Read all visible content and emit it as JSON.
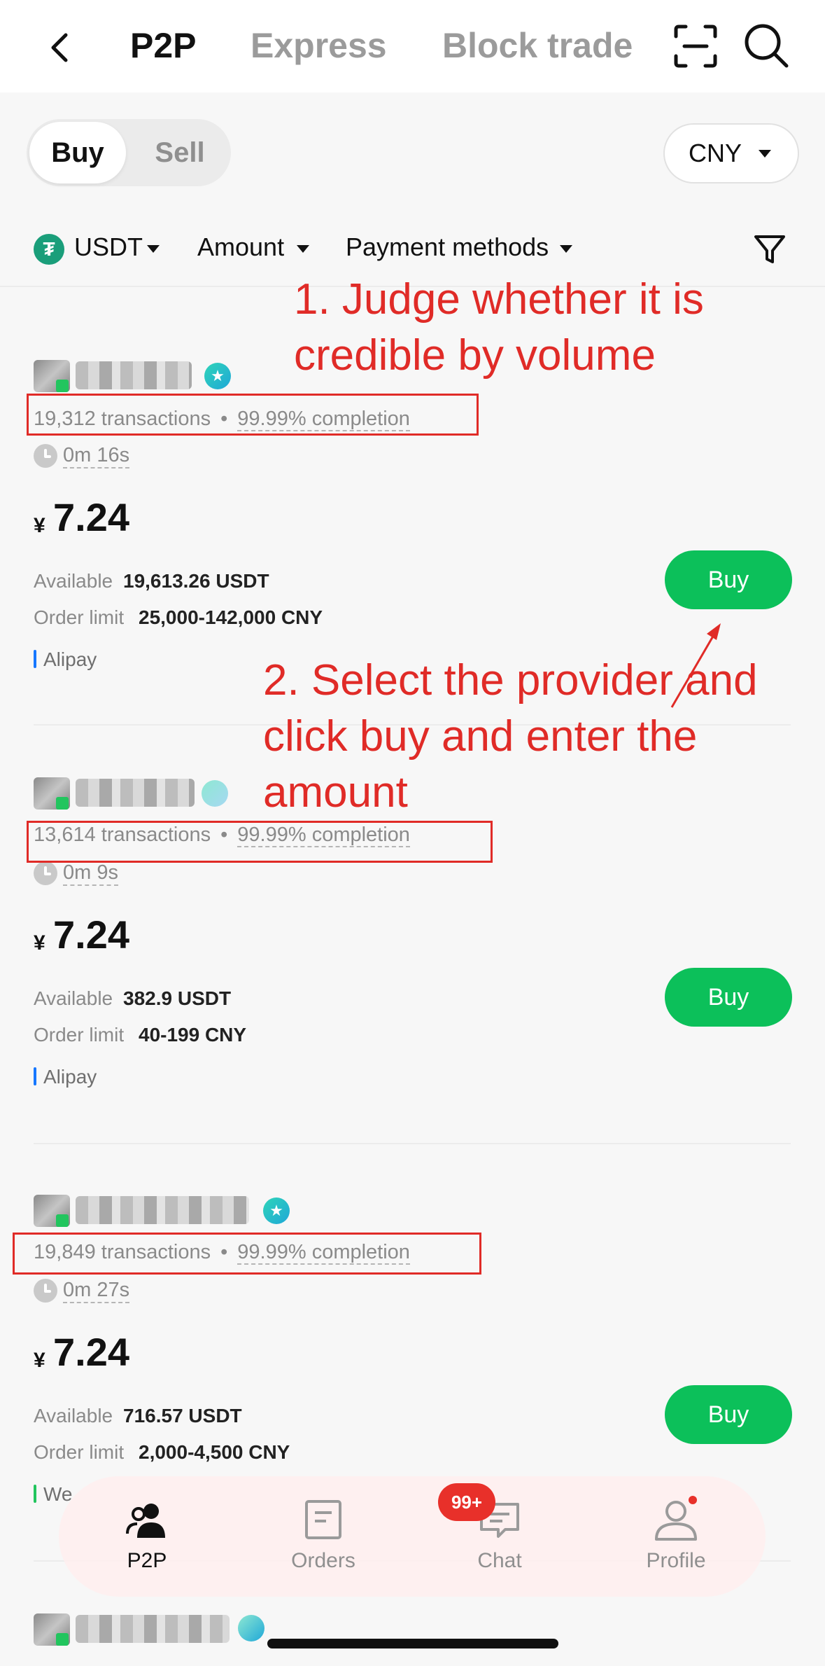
{
  "header": {
    "tabs": [
      {
        "label": "P2P",
        "active": true
      },
      {
        "label": "Express",
        "active": false
      },
      {
        "label": "Block trade",
        "active": false
      }
    ],
    "icons": [
      "back-icon",
      "scan-icon",
      "search-icon"
    ]
  },
  "trade_toggle": {
    "buy": "Buy",
    "sell": "Sell",
    "selected": "Buy"
  },
  "fiat": {
    "label": "CNY"
  },
  "filters": {
    "asset_icon_glyph": "₮",
    "asset": "USDT",
    "amount": "Amount",
    "payment": "Payment methods"
  },
  "listings": [
    {
      "transactions": "19,312 transactions",
      "completion": "99.99% completion",
      "pay_time": "0m 16s",
      "currency_symbol": "¥",
      "price": "7.24",
      "available_label": "Available",
      "available": "19,613.26 USDT",
      "limit_label": "Order limit",
      "limit": "25,000-142,000 CNY",
      "payment": "Alipay",
      "buy_label": "Buy"
    },
    {
      "transactions": "13,614 transactions",
      "completion": "99.99% completion",
      "pay_time": "0m 9s",
      "currency_symbol": "¥",
      "price": "7.24",
      "available_label": "Available",
      "available": "382.9 USDT",
      "limit_label": "Order limit",
      "limit": "40-199 CNY",
      "payment": "Alipay",
      "buy_label": "Buy"
    },
    {
      "transactions": "19,849 transactions",
      "completion": "99.99% completion",
      "pay_time": "0m 27s",
      "currency_symbol": "¥",
      "price": "7.24",
      "available_label": "Available",
      "available": "716.57 USDT",
      "limit_label": "Order limit",
      "limit": "2,000-4,500 CNY",
      "payment": "We",
      "buy_label": "Buy"
    }
  ],
  "annotations": {
    "note1_line1": "1. Judge whether it is",
    "note1_line2": "credible by volume",
    "note2_line1": "2. Select the provider and",
    "note2_line2": "click buy and enter the",
    "note2_line3": "amount"
  },
  "bottom_nav": [
    {
      "label": "P2P",
      "active": true
    },
    {
      "label": "Orders",
      "active": false
    },
    {
      "label": "Chat",
      "active": false
    },
    {
      "label": "Profile",
      "active": false
    }
  ],
  "chat_badge": "99+",
  "colors": {
    "buy_green": "#0cc05a",
    "annotation_red": "#e02b27",
    "alipay_blue": "#1677ff",
    "wechat_green": "#22c55e",
    "badge_red": "#e8302a"
  }
}
